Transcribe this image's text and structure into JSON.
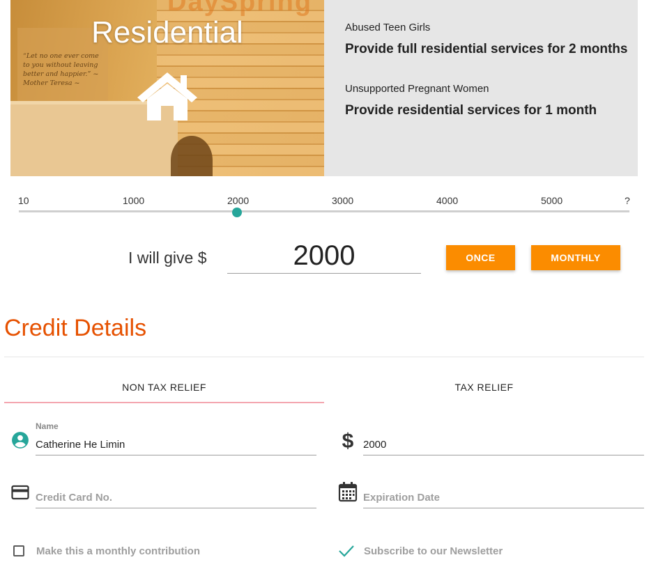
{
  "hero": {
    "title": "Residential",
    "photo_quote": "“Let no one ever come to you without leaving better and happier.” ~ Mother Teresa ~",
    "impacts": [
      {
        "category": "Abused Teen Girls",
        "description": "Provide full residential services for 2 months"
      },
      {
        "category": "Unsupported Pregnant Women",
        "description": "Provide residential services for 1 month"
      }
    ]
  },
  "slider": {
    "ticks": [
      "10",
      "1000",
      "2000",
      "3000",
      "4000",
      "5000",
      "?"
    ],
    "value": 2000
  },
  "give": {
    "label": "I will give $",
    "amount": "2000",
    "once_label": "ONCE",
    "monthly_label": "MONTHLY"
  },
  "credit": {
    "title": "Credit Details",
    "tabs": [
      "NON TAX RELIEF",
      "TAX RELIEF"
    ],
    "active_tab": 0,
    "name_label": "Name",
    "name_value": "Catherine He Limin",
    "amount_value": "2000",
    "card_placeholder": "Credit Card No.",
    "expiry_placeholder": "Expiration Date",
    "monthly_check_label": "Make this a monthly contribution",
    "newsletter_label": "Subscribe to our Newsletter"
  },
  "colors": {
    "accent": "#fb8c00",
    "title": "#e65100",
    "teal": "#26a69a",
    "tab_indicator": "#f4a6b0"
  },
  "icons": [
    "home-icon",
    "account-circle-icon",
    "dollar-icon",
    "credit-card-icon",
    "calendar-icon",
    "checkmark-icon"
  ]
}
